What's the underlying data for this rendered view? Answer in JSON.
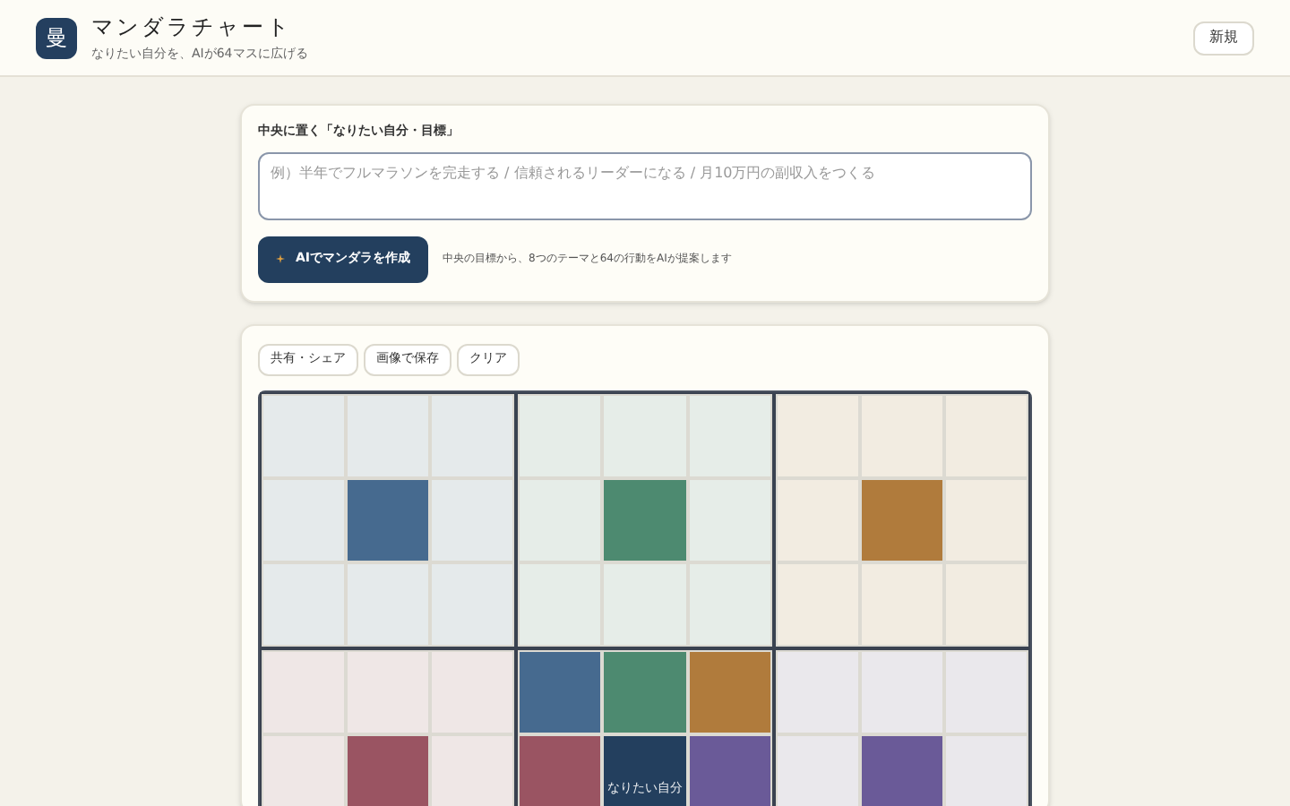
{
  "header": {
    "logo": "曼",
    "title": "マンダラチャート",
    "subtitle": "なりたい自分を、AIが64マスに広げる",
    "new_button": "新規"
  },
  "goal_form": {
    "label": "中央に置く「なりたい自分・目標」",
    "placeholder": "例）半年でフルマラソンを完走する / 信頼されるリーダーになる / 月10万円の副収入をつくる",
    "generate_button": "AIでマンダラを作成",
    "hint": "中央の目標から、8つのテーマと64の行動をAIが提案します"
  },
  "chart": {
    "actions": [
      "共有・シェア",
      "画像で保存",
      "クリア"
    ],
    "center_label": "なりたい自分",
    "themes": [
      {
        "color": "#466a8f"
      },
      {
        "color": "#4d8a70"
      },
      {
        "color": "#b07b3c"
      },
      {
        "color": "#9a5462"
      },
      {
        "color": "#6a5a98"
      }
    ]
  }
}
